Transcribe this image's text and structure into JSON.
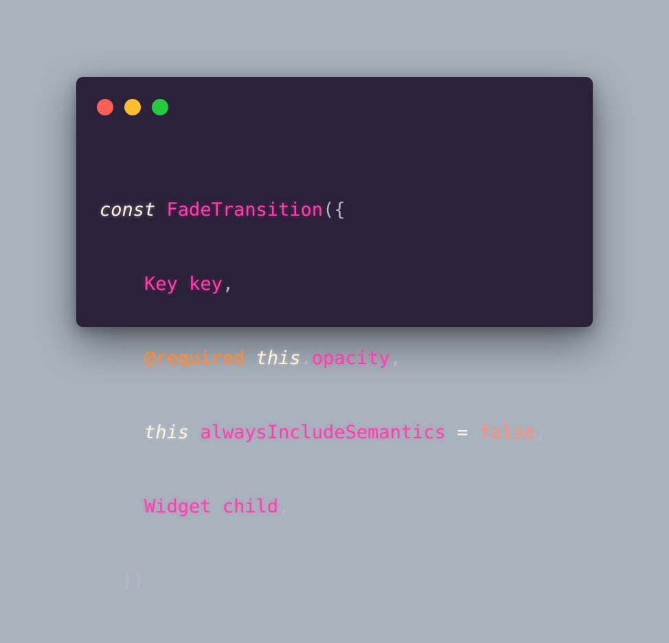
{
  "window": {
    "controls": {
      "close_color": "#ff5f56",
      "minimize_color": "#ffbd2e",
      "maximize_color": "#27c93f"
    }
  },
  "code": {
    "line1": {
      "keyword": "const",
      "name": "FadeTransition",
      "punct": "({"
    },
    "line2": {
      "indent": "    ",
      "type": "Key",
      "param": "key",
      "punct": ","
    },
    "line3": {
      "indent": "    ",
      "annotation": "@required",
      "this": "this",
      "dot": ".",
      "prop": "opacity",
      "punct": ","
    },
    "line4": {
      "indent": "    ",
      "this": "this",
      "dot": ".",
      "prop": "alwaysIncludeSemantics",
      "op": "=",
      "value": "false",
      "punct": ","
    },
    "line5": {
      "indent": "    ",
      "type": "Widget",
      "param": "child",
      "punct": ","
    },
    "line6": {
      "indent": "  ",
      "punct": "})"
    }
  }
}
